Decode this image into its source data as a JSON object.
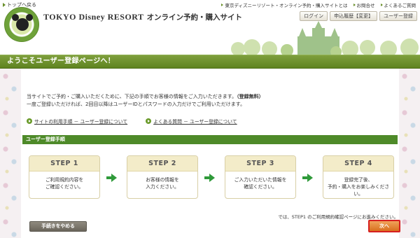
{
  "header": {
    "back_link": "トップへ戻る",
    "brand_name": "TOKYO Disney RESORT",
    "brand_subtitle": "オンライン予約・購入サイト",
    "top_links": [
      {
        "label": "東京ディズニーリゾート・オンライン予約・購入サイトとは"
      },
      {
        "label": "お問合せ"
      },
      {
        "label": "よくあるご質問"
      }
    ],
    "buttons": [
      {
        "label": "ログイン"
      },
      {
        "label": "申込履歴【変更】"
      },
      {
        "label": "ユーザー登録"
      }
    ]
  },
  "page_title": "ようこそユーザー登録ページへ！",
  "intro": {
    "line1_prefix": "当サイトでご予約・ご購入いただくために、下記の手順でお客様の情報をご入力いただきます。",
    "line1_bold": "（登録無料）",
    "line2": "一度ご登録いただければ、2回目以降はユーザーIDとパスワードの入力だけでご利用いただけます。"
  },
  "help_links": [
    {
      "label": "サイトの利用手順 － ユーザー登録について"
    },
    {
      "label": "よくある質問 － ユーザー登録について"
    }
  ],
  "steps_header": "ユーザー登録手順",
  "steps": [
    {
      "title": "STEP 1",
      "line1": "ご利用規約内容を",
      "line2": "ご確認ください。"
    },
    {
      "title": "STEP 2",
      "line1": "お客様の情報を",
      "line2": "入力ください。"
    },
    {
      "title": "STEP 3",
      "line1": "ご入力いただいた情報を",
      "line2": "確認ください。"
    },
    {
      "title": "STEP 4",
      "line1": "登録完了後、",
      "line2": "予約・購入をお楽しみください。"
    }
  ],
  "next_note": "では、STEP1 のご利用規約確認ページにお進みください。",
  "cancel_button": "手続きをやめる",
  "next_button": "次へ",
  "colors": {
    "title_bar": "#5f8420",
    "steps_header": "#4e8a29",
    "step_arrow": "#2f9a3a",
    "next_button": "#d96f1e",
    "next_button_border": "#d61f1f"
  }
}
